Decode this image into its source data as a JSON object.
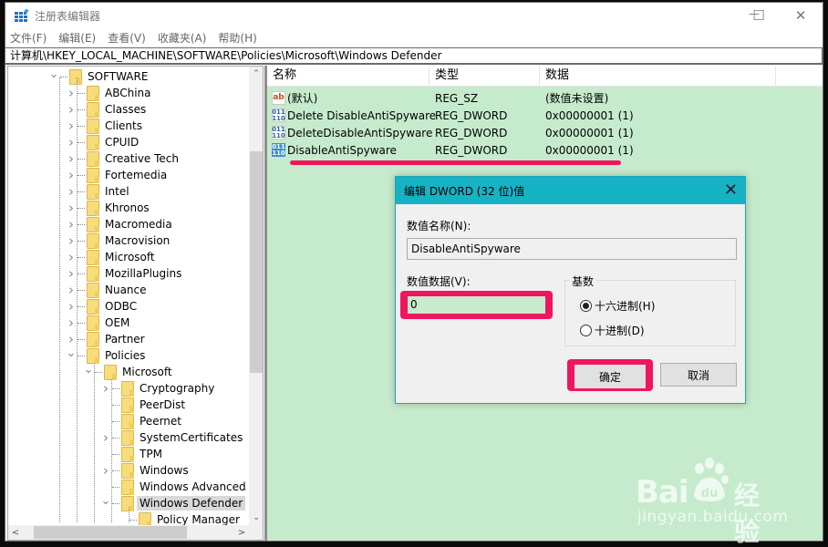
{
  "window": {
    "title": "注册表编辑器",
    "controls": {
      "minimize": "—",
      "maximize": "☐",
      "close": "✕"
    }
  },
  "menu": [
    "文件(F)",
    "编辑(E)",
    "查看(V)",
    "收藏夹(A)",
    "帮助(H)"
  ],
  "address": "计算机\\HKEY_LOCAL_MACHINE\\SOFTWARE\\Policies\\Microsoft\\Windows Defender",
  "tree": {
    "items": [
      {
        "label": "SOFTWARE",
        "level": 0,
        "expander": "expanded"
      },
      {
        "label": "ABChina",
        "level": 1,
        "expander": "collapsed"
      },
      {
        "label": "Classes",
        "level": 1,
        "expander": "collapsed"
      },
      {
        "label": "Clients",
        "level": 1,
        "expander": "collapsed"
      },
      {
        "label": "CPUID",
        "level": 1,
        "expander": "collapsed"
      },
      {
        "label": "Creative Tech",
        "level": 1,
        "expander": "collapsed"
      },
      {
        "label": "Fortemedia",
        "level": 1,
        "expander": "collapsed"
      },
      {
        "label": "Intel",
        "level": 1,
        "expander": "collapsed"
      },
      {
        "label": "Khronos",
        "level": 1,
        "expander": "collapsed"
      },
      {
        "label": "Macromedia",
        "level": 1,
        "expander": "collapsed"
      },
      {
        "label": "Macrovision",
        "level": 1,
        "expander": "collapsed"
      },
      {
        "label": "Microsoft",
        "level": 1,
        "expander": "collapsed"
      },
      {
        "label": "MozillaPlugins",
        "level": 1,
        "expander": "collapsed"
      },
      {
        "label": "Nuance",
        "level": 1,
        "expander": "collapsed"
      },
      {
        "label": "ODBC",
        "level": 1,
        "expander": "collapsed"
      },
      {
        "label": "OEM",
        "level": 1,
        "expander": "collapsed"
      },
      {
        "label": "Partner",
        "level": 1,
        "expander": "collapsed"
      },
      {
        "label": "Policies",
        "level": 1,
        "expander": "expanded"
      },
      {
        "label": "Microsoft",
        "level": 2,
        "expander": "expanded"
      },
      {
        "label": "Cryptography",
        "level": 3,
        "expander": "collapsed"
      },
      {
        "label": "PeerDist",
        "level": 3,
        "expander": "none"
      },
      {
        "label": "Peernet",
        "level": 3,
        "expander": "none"
      },
      {
        "label": "SystemCertificates",
        "level": 3,
        "expander": "collapsed"
      },
      {
        "label": "TPM",
        "level": 3,
        "expander": "none"
      },
      {
        "label": "Windows",
        "level": 3,
        "expander": "collapsed"
      },
      {
        "label": "Windows Advanced Th",
        "level": 3,
        "expander": "none"
      },
      {
        "label": "Windows Defender",
        "level": 3,
        "expander": "expanded",
        "selected": true
      },
      {
        "label": "Policy Manager",
        "level": 4,
        "expander": "none"
      }
    ],
    "scroll": {
      "up": "⌃",
      "down": "⌄",
      "left": "<",
      "right": ">"
    }
  },
  "list": {
    "headers": {
      "name": "名称",
      "type": "类型",
      "data": "数据"
    },
    "rows": [
      {
        "icon": "string-value-icon",
        "icon_text": "ab",
        "name": "(默认)",
        "type": "REG_SZ",
        "data": "(数值未设置)"
      },
      {
        "icon": "dword-value-icon",
        "icon_text": "011 110",
        "name": "Delete DisableAntiSpyware",
        "type": "REG_DWORD",
        "data": "0x00000001 (1)"
      },
      {
        "icon": "dword-value-icon",
        "icon_text": "011 110",
        "name": "DeleteDisableAntiSpyware",
        "type": "REG_DWORD",
        "data": "0x00000001 (1)"
      },
      {
        "icon": "dword-value-icon",
        "icon_text": "011 110",
        "name": "DisableAntiSpyware",
        "type": "REG_DWORD",
        "data": "0x00000001 (1)",
        "selected": true
      }
    ]
  },
  "dialog": {
    "title": "编辑 DWORD (32 位)值",
    "close": "✕",
    "name_label": "数值名称(N):",
    "name_value": "DisableAntiSpyware",
    "data_label": "数值数据(V):",
    "data_value": "0",
    "base_label": "基数",
    "radio_hex": "十六进制(H)",
    "radio_dec": "十进制(D)",
    "selected_base": "hex",
    "ok": "确定",
    "cancel": "取消"
  },
  "annotations": {
    "highlight_color": "#f01560"
  },
  "watermark": {
    "brand": "Bai",
    "brand_du": "du",
    "cn": "经验",
    "url": "jingyan.baidu.com"
  }
}
